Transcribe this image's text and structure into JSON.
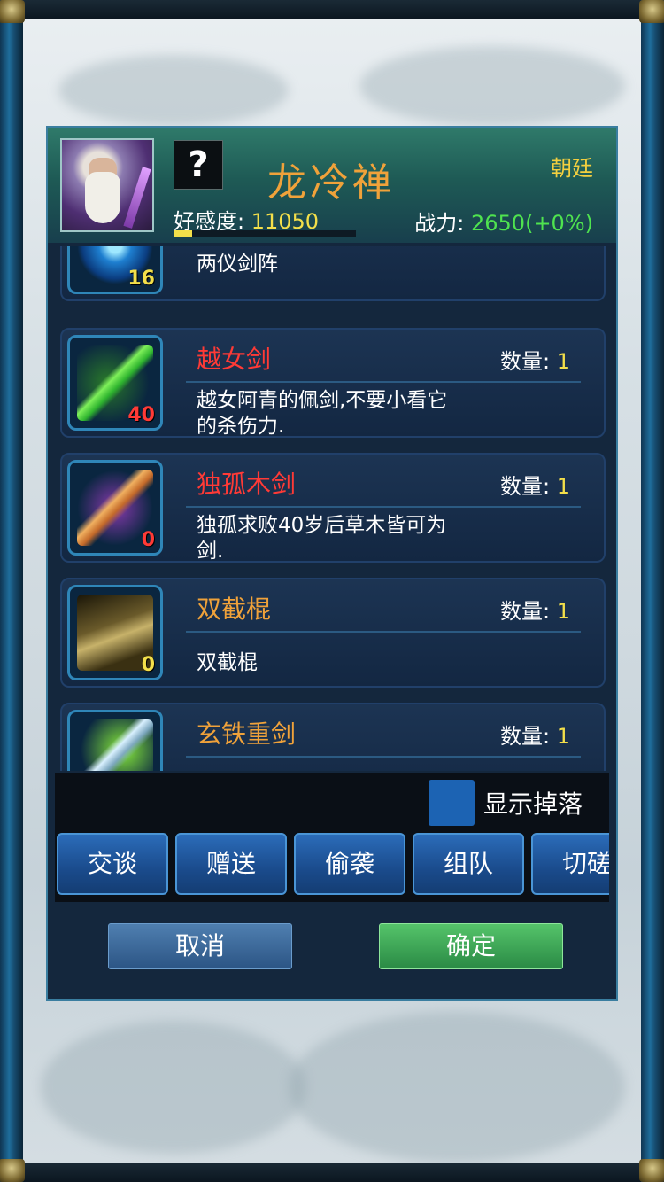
{
  "header": {
    "npc_name": "龙冷禅",
    "faction": "朝廷",
    "mystery_mark": "?",
    "favor_label": "好感度: ",
    "favor_value": "11050",
    "favor_progress": 0.1,
    "power_label": "战力: ",
    "power_value": "2650(+0%)"
  },
  "items": [
    {
      "name": "",
      "desc": "两仪剑阵",
      "count": "16",
      "qty_label": "",
      "qty_value": "",
      "name_color": "#f0a23a",
      "count_color": "#f3df4a",
      "icon": "sword-formation-icon"
    },
    {
      "name": "越女剑",
      "desc": "越女阿青的佩剑,不要小看它的杀伤力.",
      "count": "40",
      "qty_label": "数量: ",
      "qty_value": "1",
      "name_color": "#ff3a36",
      "count_color": "#ff3a36",
      "icon": "green-sword-icon"
    },
    {
      "name": "独孤木剑",
      "desc": "独孤求败40岁后草木皆可为剑.",
      "count": "0",
      "qty_label": "数量: ",
      "qty_value": "1",
      "name_color": "#ff3a36",
      "count_color": "#ff3a36",
      "icon": "wooden-sword-icon"
    },
    {
      "name": "双截棍",
      "desc": "双截棍",
      "count": "0",
      "qty_label": "数量: ",
      "qty_value": "1",
      "name_color": "#f0a23a",
      "count_color": "#f3df4a",
      "icon": "nunchaku-icon"
    },
    {
      "name": "玄铁重剑",
      "desc": "",
      "count": "",
      "qty_label": "数量: ",
      "qty_value": "1",
      "name_color": "#f0a23a",
      "count_color": "#f3df4a",
      "icon": "heavy-sword-icon"
    }
  ],
  "toolbar": {
    "show_drops_label": "显示掉落",
    "actions": [
      "交谈",
      "赠送",
      "偷袭",
      "组队",
      "切磋"
    ]
  },
  "buttons": {
    "cancel": "取消",
    "confirm": "确定"
  }
}
